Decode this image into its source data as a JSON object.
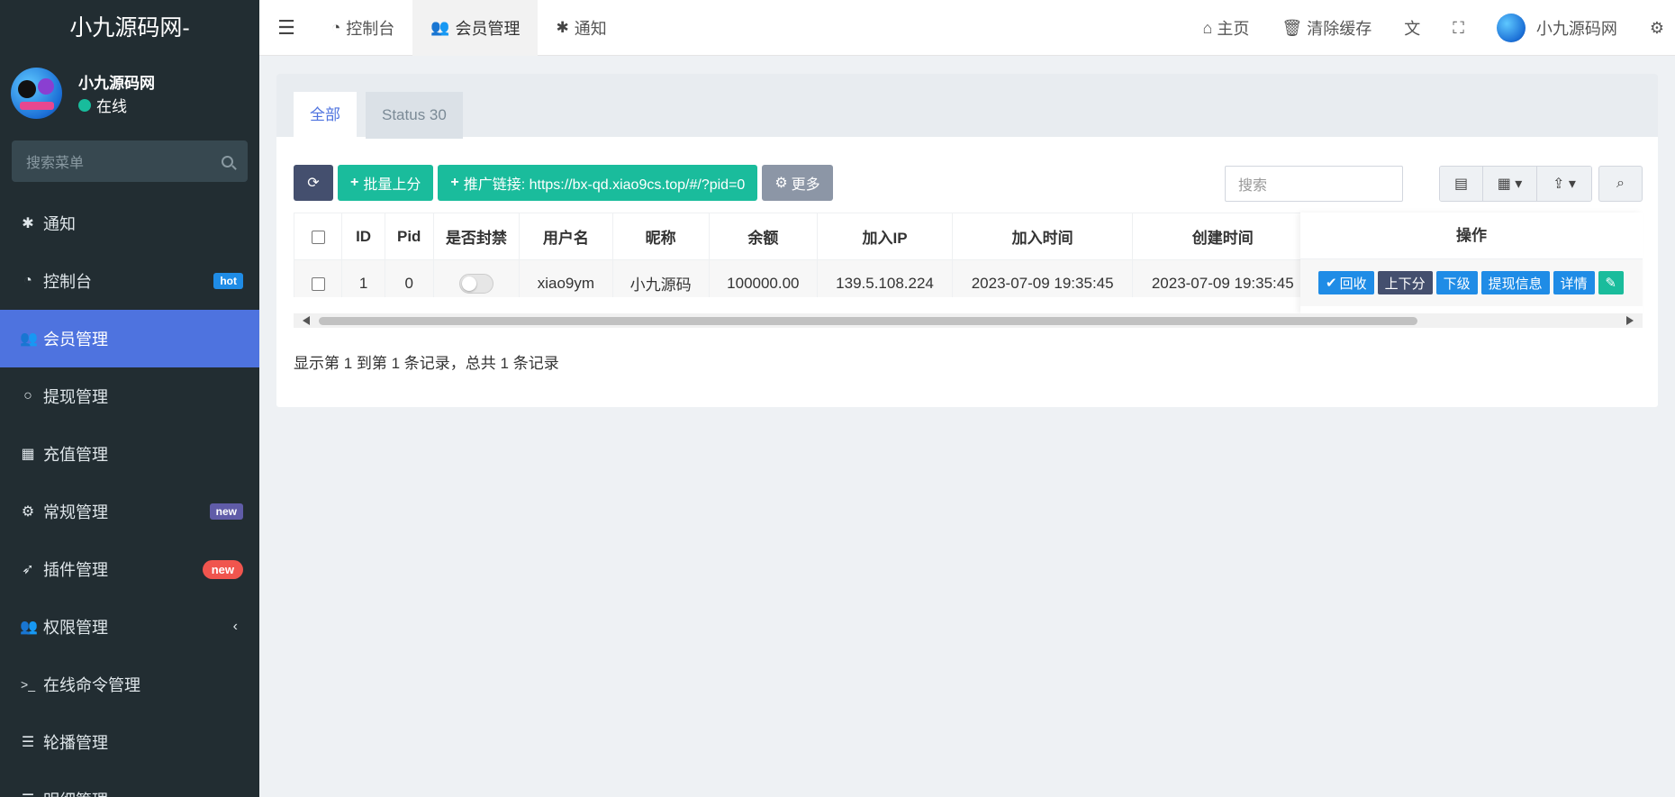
{
  "sidebar": {
    "logo": "小九源码网-",
    "user": {
      "name": "小九源码网",
      "status": "在线"
    },
    "search_placeholder": "搜索菜单",
    "items": [
      {
        "label": "通知",
        "icon": "asterisk-icon"
      },
      {
        "label": "控制台",
        "icon": "dashboard-icon",
        "badge": "hot"
      },
      {
        "label": "会员管理",
        "icon": "users-icon",
        "active": true
      },
      {
        "label": "提现管理",
        "icon": "circle-icon"
      },
      {
        "label": "充值管理",
        "icon": "grid-icon"
      },
      {
        "label": "常规管理",
        "icon": "gears-icon",
        "badge": "new"
      },
      {
        "label": "插件管理",
        "icon": "rocket-icon",
        "badge": "new"
      },
      {
        "label": "权限管理",
        "icon": "group-icon"
      },
      {
        "label": "在线命令管理",
        "icon": "terminal-icon"
      },
      {
        "label": "轮播管理",
        "icon": "bars-icon"
      },
      {
        "label": "明细管理",
        "icon": "list-icon"
      }
    ]
  },
  "topnav": {
    "tabs": [
      {
        "label": "控制台"
      },
      {
        "label": "会员管理"
      },
      {
        "label": "通知"
      }
    ],
    "right": {
      "home": "主页",
      "clear_cache": "清除缓存",
      "user": "小九源码网"
    }
  },
  "panel": {
    "tabs": [
      "全部",
      "Status 30"
    ],
    "toolbar": {
      "batch": "批量上分",
      "promo": "推广链接: https://bx-qd.xiao9cs.top/#/?pid=0",
      "more": "更多"
    },
    "search_placeholder": "搜索",
    "columns": [
      "ID",
      "Pid",
      "是否封禁",
      "用户名",
      "昵称",
      "余额",
      "加入IP",
      "加入时间",
      "创建时间",
      "操作"
    ],
    "rows": [
      {
        "id": "1",
        "pid": "0",
        "username": "xiao9ym",
        "nickname": "小九源码",
        "balance": "100000.00",
        "ip": "139.5.108.224",
        "join_time": "2023-07-09 19:35:45",
        "create_time": "2023-07-09 19:35:45"
      }
    ],
    "ops": {
      "recycle": "回收",
      "updown": "上下分",
      "sub": "下级",
      "withdraw": "提现信息",
      "detail": "详情"
    },
    "footer": "显示第 1 到第 1 条记录，总共 1 条记录"
  },
  "colors": {
    "sidebar_bg": "#222d32",
    "accent": "#4e73df",
    "green": "#1abc9c",
    "blue": "#1f8ce6",
    "dark_btn": "#444f6e"
  }
}
